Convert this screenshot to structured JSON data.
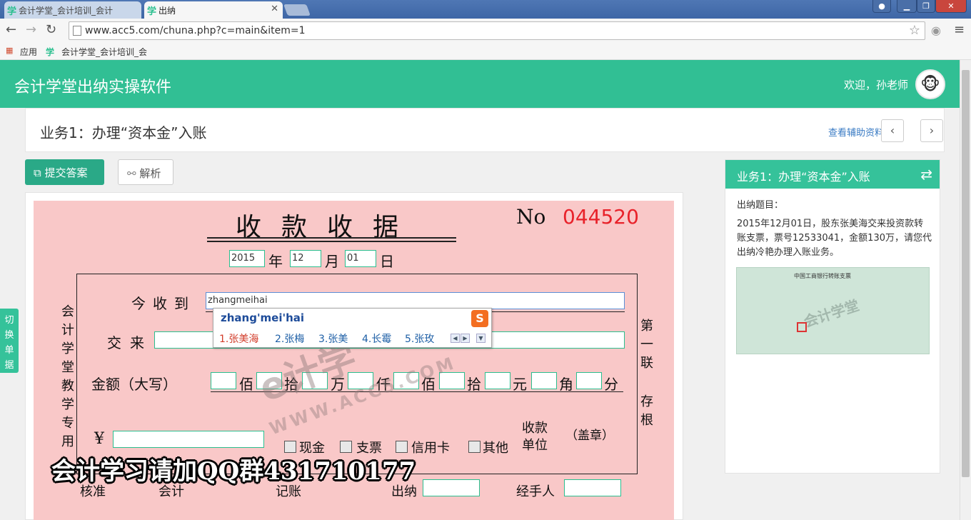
{
  "browser": {
    "tabs": [
      {
        "label": "会计学堂_会计培训_会计",
        "active": false
      },
      {
        "label": "出纳",
        "active": true
      }
    ],
    "tab_favicon": "学",
    "url": "www.acc5.com/chuna.php?c=main&item=1",
    "bookmarks": [
      {
        "label": "应用",
        "icon": "apps-grid-icon"
      },
      {
        "label": "会计学堂_会计培训_会",
        "icon": "favicon-xue"
      }
    ]
  },
  "app": {
    "title": "会计学堂出纳实操软件",
    "welcome": "欢迎，孙老师",
    "brand_color": "#31bf94"
  },
  "task": {
    "title": "业务1：办理“资本金”入账",
    "help_link": "查看辅助资料",
    "prev": "‹",
    "next": "›"
  },
  "actions": {
    "submit": "提交答案",
    "analysis": "解析",
    "switch": "切换单据"
  },
  "receipt": {
    "title": "收款收据",
    "no_label": "No",
    "no_value": "044520",
    "date": {
      "year": "2015",
      "year_label": "年",
      "month": "12",
      "month_label": "月",
      "day": "01",
      "day_label": "日"
    },
    "left_vertical": "会计学堂教学专用",
    "right_vertical_1": "第一联",
    "right_vertical_2": "存根",
    "received_from_label": "今收到",
    "received_from_value": "zhangmeihai",
    "purpose_label": "交来",
    "amount_label": "金额（大写）",
    "amount_units": [
      "佰",
      "拾",
      "万",
      "仟",
      "佰",
      "拾",
      "元",
      "角",
      "分"
    ],
    "yuan_symbol": "¥",
    "payment_methods": [
      "现金",
      "支票",
      "信用卡",
      "其他"
    ],
    "collector_label": "收款单位",
    "stamp_label": "（盖章）",
    "signatures": [
      "核准",
      "会计",
      "记账",
      "出纳",
      "经手人"
    ]
  },
  "ime": {
    "composition": "zhang'mei'hai",
    "candidates": [
      "1.张美海",
      "2.张梅",
      "3.张美",
      "4.长霉",
      "5.张玫"
    ],
    "logo": "S"
  },
  "overlay": {
    "qq_text": "会计学习请加QQ群431710177",
    "watermark_text": "e计 学",
    "watermark_url": "WWW.ACC5.COM"
  },
  "side": {
    "title": "业务1：办理“资本金”入账",
    "question_label": "出纳题目：",
    "description": "2015年12月01日，股东张美海交来投资款转账支票，票号12533041，金额130万，请您代出纳冷艳办理入账业务。",
    "cheque_title": "中国工商银行转账支票",
    "cheque_watermark": "会计学堂"
  }
}
